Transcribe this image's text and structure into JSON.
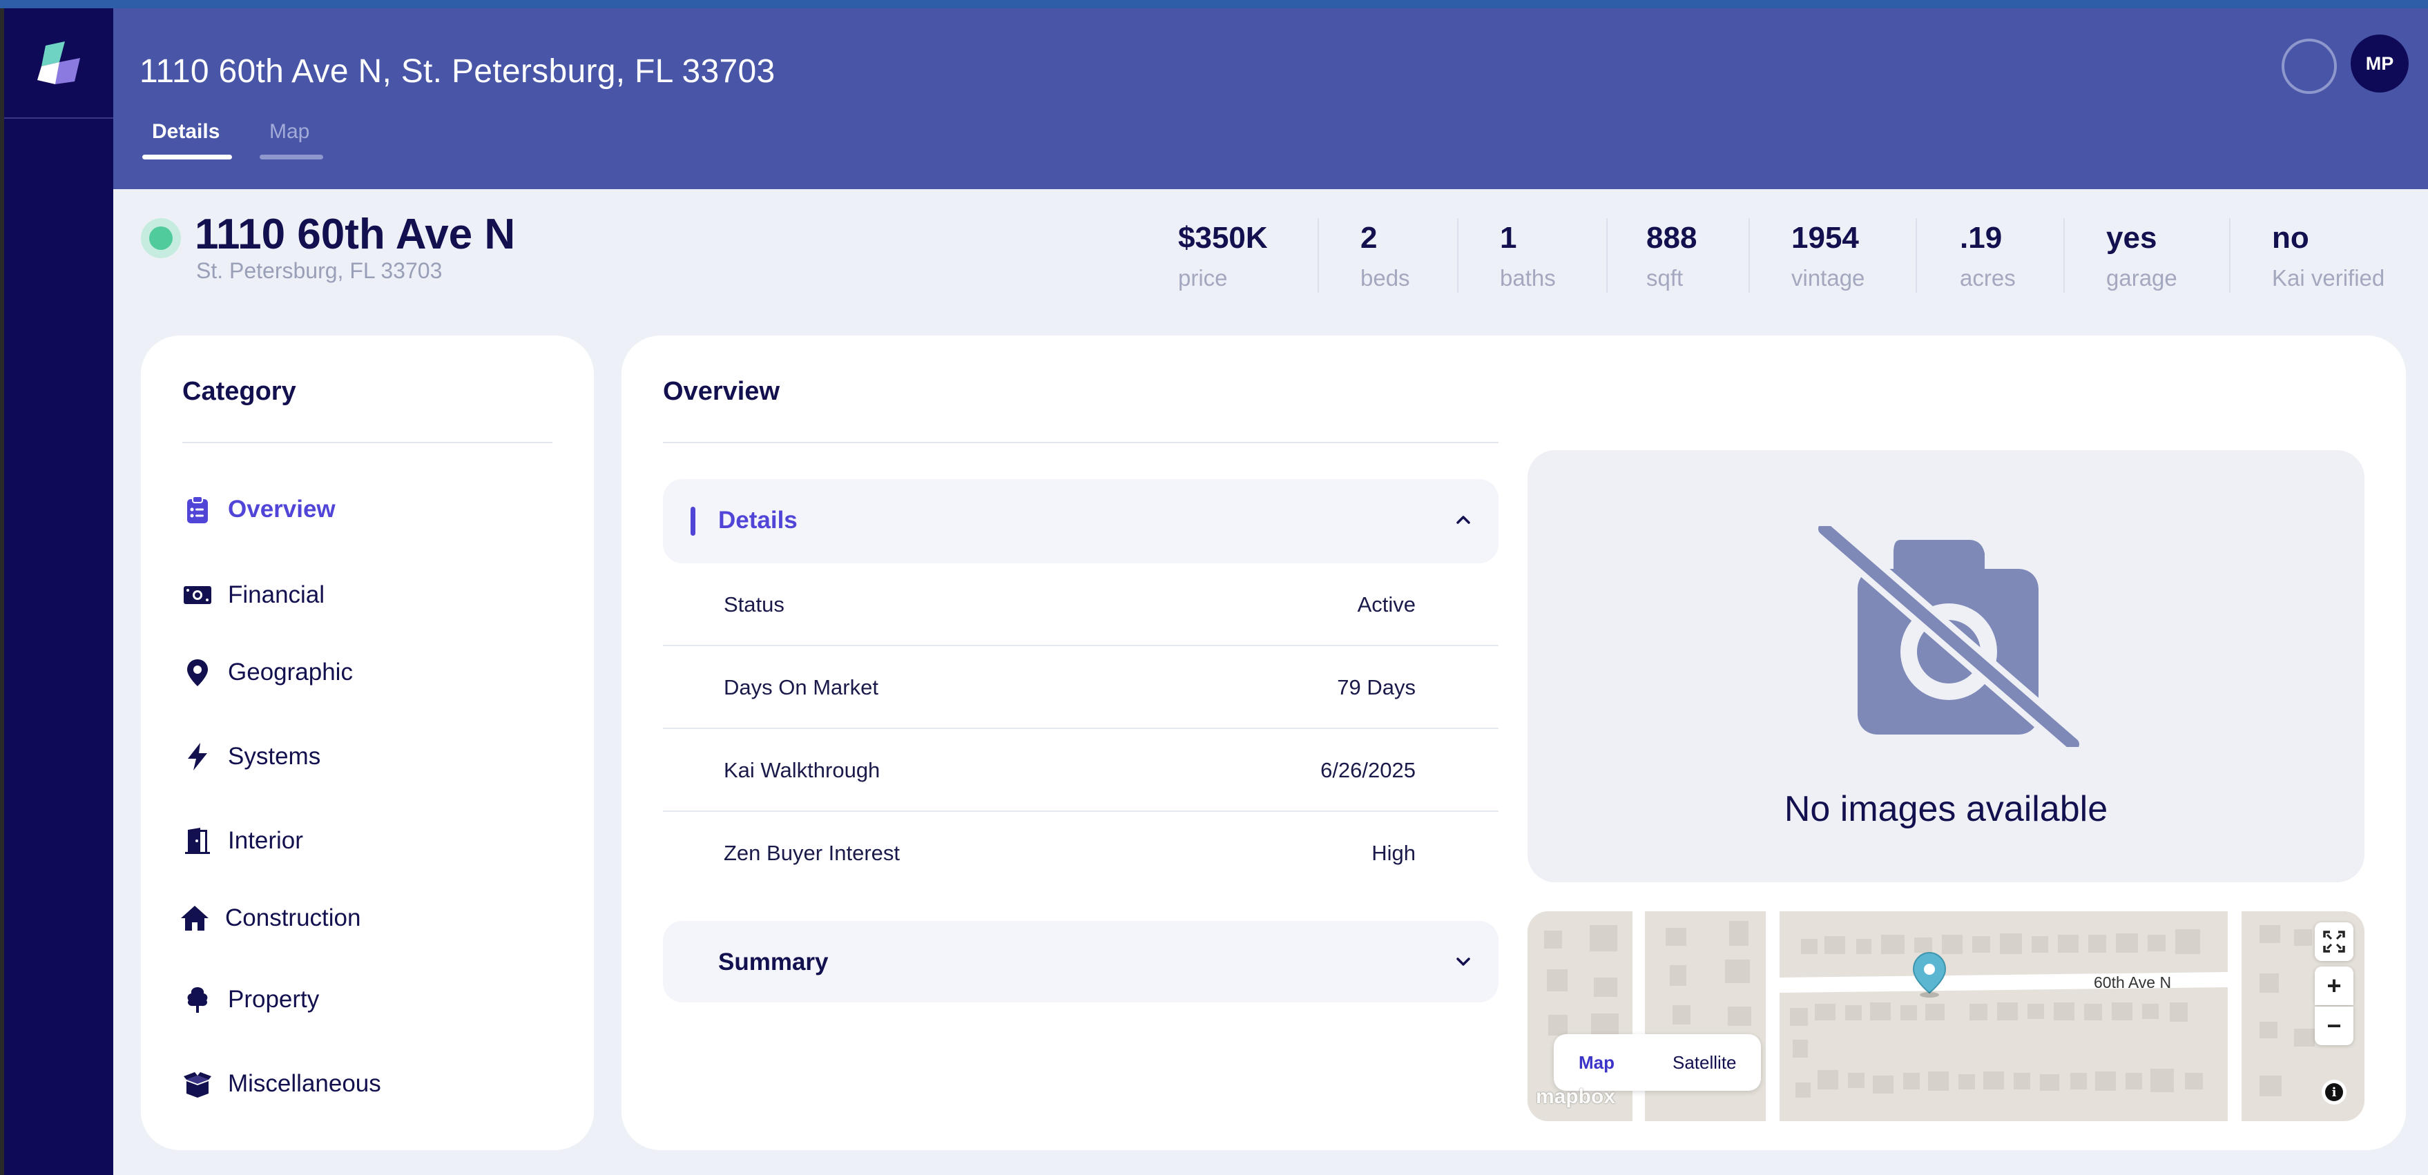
{
  "header": {
    "title": "1110 60th Ave N, St. Petersburg, FL 33703",
    "tabs": [
      {
        "label": "Details",
        "active": true
      },
      {
        "label": "Map",
        "active": false
      }
    ],
    "avatar_initials": "MP"
  },
  "property": {
    "name": "1110 60th Ave N",
    "city": "St. Petersburg, FL 33703",
    "status_color": "#4fcb9c"
  },
  "stats": [
    {
      "value": "$350K",
      "label": "price"
    },
    {
      "value": "2",
      "label": "beds"
    },
    {
      "value": "1",
      "label": "baths"
    },
    {
      "value": "888",
      "label": "sqft"
    },
    {
      "value": "1954",
      "label": "vintage"
    },
    {
      "value": ".19",
      "label": "acres"
    },
    {
      "value": "yes",
      "label": "garage"
    },
    {
      "value": "no",
      "label": "Kai verified"
    }
  ],
  "category": {
    "title": "Category",
    "items": [
      {
        "label": "Overview",
        "icon": "clipboard-list-icon",
        "active": true
      },
      {
        "label": "Financial",
        "icon": "money-bill-icon",
        "active": false
      },
      {
        "label": "Geographic",
        "icon": "map-pin-icon",
        "active": false
      },
      {
        "label": "Systems",
        "icon": "lightning-bolt-icon",
        "active": false
      },
      {
        "label": "Interior",
        "icon": "door-open-icon",
        "active": false
      },
      {
        "label": "Construction",
        "icon": "house-icon",
        "active": false
      },
      {
        "label": "Property",
        "icon": "tree-icon",
        "active": false
      },
      {
        "label": "Miscellaneous",
        "icon": "box-open-icon",
        "active": false
      }
    ]
  },
  "overview": {
    "title": "Overview",
    "details_title": "Details",
    "details_rows": [
      {
        "key": "Status",
        "value": "Active"
      },
      {
        "key": "Days On Market",
        "value": "79 Days"
      },
      {
        "key": "Kai Walkthrough",
        "value": "6/26/2025"
      },
      {
        "key": "Zen Buyer Interest",
        "value": "High"
      }
    ],
    "summary_title": "Summary",
    "no_images_text": "No images available"
  },
  "map": {
    "toggle_map": "Map",
    "toggle_satellite": "Satellite",
    "street_label": "60th Ave N",
    "watermark": "mapbox"
  },
  "colors": {
    "accent": "#5145d8",
    "header": "#4956a8",
    "sidebar": "#0f0a57",
    "pin": "#5bb7d1"
  }
}
